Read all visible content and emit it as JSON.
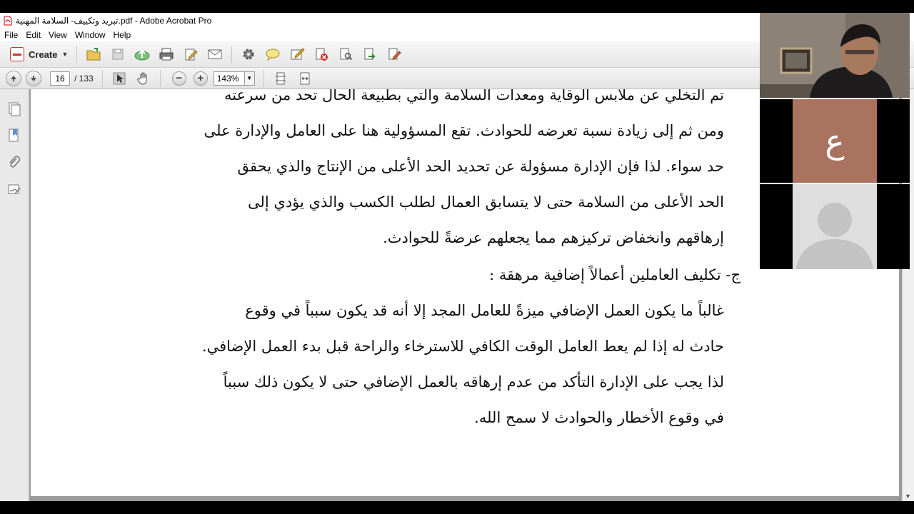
{
  "window": {
    "title": "تبريد وتكييف- السلامة المهنية.pdf - Adobe Acrobat Pro"
  },
  "menu": [
    "File",
    "Edit",
    "View",
    "Window",
    "Help"
  ],
  "toolbar": {
    "create_label": "Create",
    "icons": [
      "open-icon",
      "save-icon",
      "upload-icon",
      "print-icon",
      "edit-icon",
      "email-icon",
      "settings-icon",
      "comment-icon",
      "sign-icon",
      "stop-icon",
      "search-doc-icon",
      "export-icon",
      "form-icon"
    ]
  },
  "navigation": {
    "current_page": "16",
    "total_pages": "/ 133",
    "zoom": "143%"
  },
  "document": {
    "paragraph1": [
      "تم التخلي عن ملابس الوقاية ومعدات السلامة والتي بطبيعة الحال تحد من سرعته",
      "ومن ثم إلى زيادة نسبة تعرضه للحوادث.  تقع المسؤولية هنا على العامل والإدارة على",
      "حد سواء.  لذا فإن الإدارة مسؤولة عن تحديد الحد الأعلى من الإنتاج والذي يحقق",
      "الحد الأعلى من السلامة حتى لا يتسابق العمال لطلب الكسب والذي يؤدي إلى",
      "إرهاقهم وانخفاض تركيزهم مما يجعلهم عرضةً للحوادث."
    ],
    "heading": "ج-   تكليف العاملين أعمالاً إضافية مرهقة :",
    "paragraph2": [
      "غالباً ما يكون العمل الإضافي ميزةً للعامل المجد إلا أنه قد يكون سبباً في وقوع",
      "حادث له إذا لم يعط العامل الوقت الكافي للاسترخاء والراحة قبل بدء العمل الإضافي.",
      "لذا يجب على الإدارة التأكد من عدم إرهاقه بالعمل الإضافي حتى لا يكون ذلك سبباً",
      "في وقوع الأخطار والحوادث لا سمح الله."
    ]
  },
  "video_panel": {
    "participant_initial": "ع"
  },
  "colors": {
    "letter_tile": "#a9735f",
    "avatar_tile": "#dedede"
  }
}
